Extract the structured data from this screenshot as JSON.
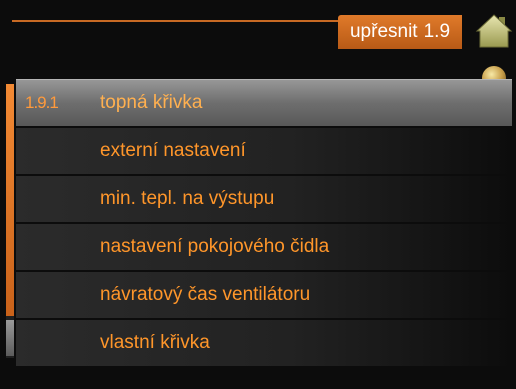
{
  "header": {
    "title": "upřesnit",
    "menu_number": "1.9"
  },
  "icons": {
    "home": "home-icon",
    "bulb": "light-bulb-icon"
  },
  "colors": {
    "accent": "#e07a2a",
    "text": "#ff962a",
    "background": "#0c0c0c"
  },
  "menu": {
    "items": [
      {
        "code": "1.9.1",
        "label": "topná křivka",
        "selected": true
      },
      {
        "code": "",
        "label": "externí nastavení"
      },
      {
        "code": "",
        "label": "min. tepl. na výstupu"
      },
      {
        "code": "",
        "label": "nastavení pokojového čidla"
      },
      {
        "code": "",
        "label": "návratový čas ventilátoru"
      },
      {
        "code": "",
        "label": "vlastní křivka"
      }
    ]
  }
}
